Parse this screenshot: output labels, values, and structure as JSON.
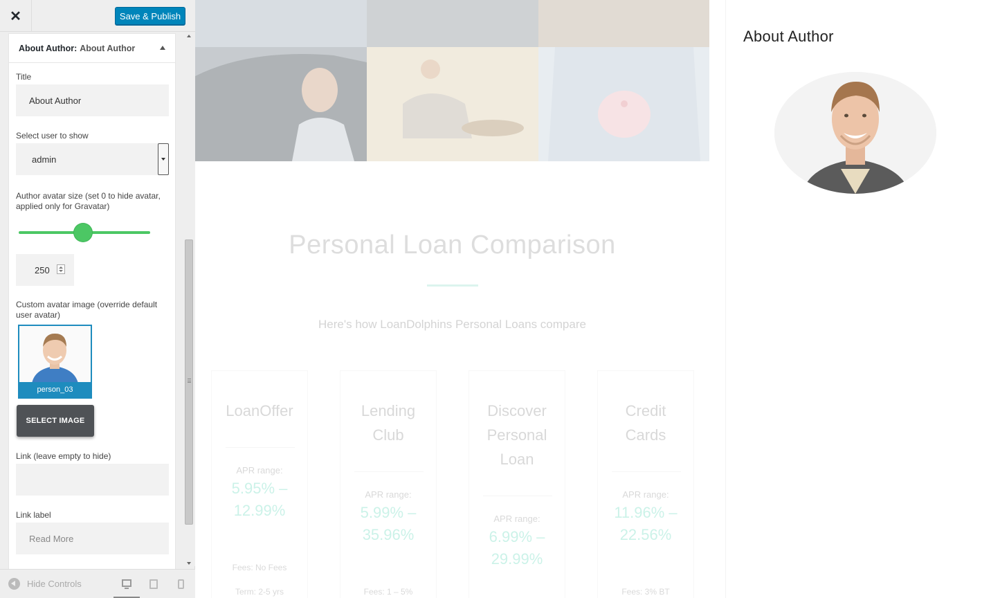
{
  "customizer": {
    "close_label": "✕",
    "publish_label": "Save & Publish",
    "widget_header": {
      "prefix": "About Author:",
      "name": "About Author"
    },
    "fields": {
      "title_label": "Title",
      "title_value": "About Author",
      "user_label": "Select user to show",
      "user_value": "admin",
      "avatar_size_label": "Author avatar size (set 0 to hide avatar, applied only for Gravatar)",
      "avatar_size_value": "250",
      "custom_avatar_label": "Custom avatar image (override default user avatar)",
      "avatar_filename": "person_03",
      "select_image_label": "SELECT IMAGE",
      "link_label": "Link (leave empty to hide)",
      "link_value": "",
      "link_text_label": "Link label",
      "link_text_placeholder": "Read More"
    },
    "footer": {
      "hide_controls_label": "Hide Controls",
      "devices": [
        "desktop-icon",
        "tablet-icon",
        "mobile-icon"
      ]
    },
    "accent_color": "#0085ba",
    "slider_color": "#4cc764"
  },
  "preview": {
    "heading": "Personal Loan Comparison",
    "subheading": "Here's how LoanDolphins Personal Loans compare",
    "cards": [
      {
        "name": "LoanOffer",
        "apr_label": "APR range:",
        "apr": "5.95% – 12.99%",
        "extra": "Fees: No Fees",
        "extra2": "Term: 2-5 yrs"
      },
      {
        "name": "Lending Club",
        "apr_label": "APR range:",
        "apr": "5.99% – 35.96%",
        "extra": "Fees: 1 – 5%"
      },
      {
        "name": "Discover Personal Loan",
        "apr_label": "APR range:",
        "apr": "6.99% – 29.99%",
        "extra": ""
      },
      {
        "name": "Credit Cards",
        "apr_label": "APR range:",
        "apr": "11.96% – 22.56%",
        "extra": "Fees: 3% BT"
      }
    ],
    "sidebar_widget_title": "About Author",
    "accent_teal": "#48d1b0"
  }
}
